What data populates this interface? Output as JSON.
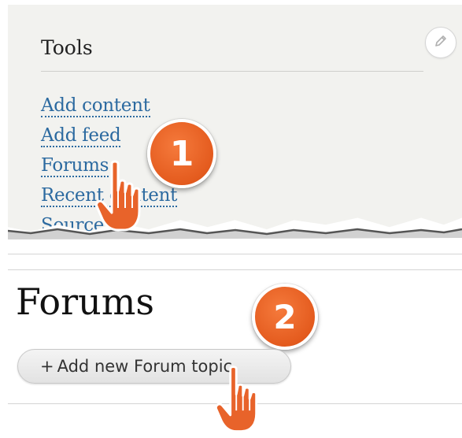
{
  "tools_block": {
    "title": "Tools",
    "edit_icon": "pencil-icon",
    "links": [
      {
        "label": "Add content"
      },
      {
        "label": "Add feed"
      },
      {
        "label": "Forums"
      },
      {
        "label": "Recent content"
      },
      {
        "label": "Sources"
      }
    ]
  },
  "forums_page": {
    "title": "Forums",
    "add_button": {
      "plus": "+",
      "label": "Add new Forum topic"
    }
  },
  "steps": [
    {
      "number": "1"
    },
    {
      "number": "2"
    }
  ],
  "colors": {
    "panel_bg": "#f2f2ef",
    "link": "#2c6aa0",
    "badge": "#e45b1e",
    "cursor": "#e45b1e"
  },
  "icons": [
    "pencil-icon",
    "hand-pointer-icon"
  ]
}
